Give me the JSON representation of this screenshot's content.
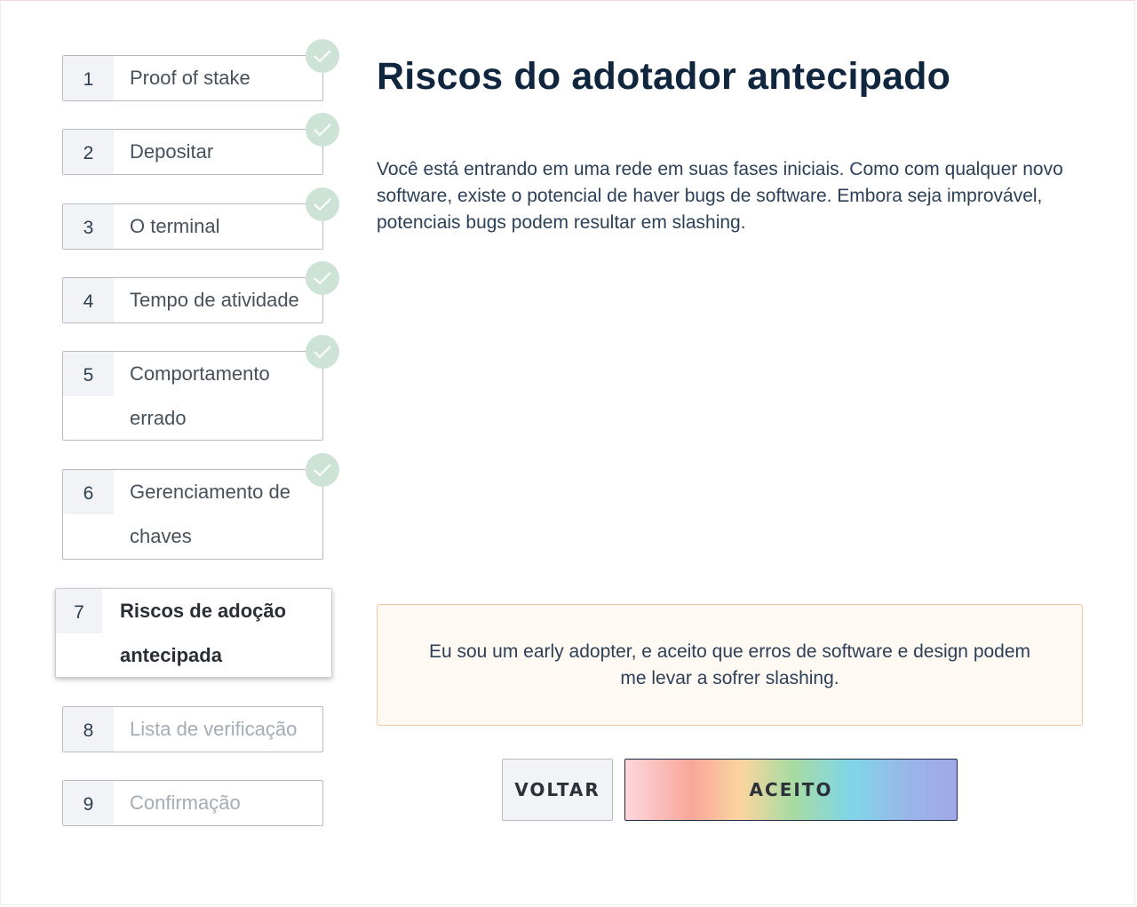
{
  "steps": [
    {
      "number": "1",
      "label": "Proof of stake",
      "state": "done"
    },
    {
      "number": "2",
      "label": "Depositar",
      "state": "done"
    },
    {
      "number": "3",
      "label": "O terminal",
      "state": "done"
    },
    {
      "number": "4",
      "label": "Tempo de atividade",
      "state": "done"
    },
    {
      "number": "5",
      "label": "Comportamento errado",
      "state": "done"
    },
    {
      "number": "6",
      "label": "Gerenciamento de chaves",
      "state": "done"
    },
    {
      "number": "7",
      "label": "Riscos de adoção antecipada",
      "state": "active"
    },
    {
      "number": "8",
      "label": "Lista de verificação",
      "state": "future"
    },
    {
      "number": "9",
      "label": "Confirmação",
      "state": "future"
    }
  ],
  "main": {
    "title": "Riscos do adotador antecipado",
    "body": "Você está entrando em uma rede em suas fases iniciais. Como com qualquer novo software, existe o potencial de haver bugs de software. Embora seja improvável, potenciais bugs podem resultar em slashing.",
    "acknowledgement": "Eu sou um early adopter, e aceito que erros de software e design podem me levar a sofrer slashing."
  },
  "buttons": {
    "back_label": "VOLTAR",
    "accept_label": "ACEITO"
  },
  "icons": {
    "completed": "check-icon"
  },
  "colors": {
    "check_circle": "#cde3d6",
    "ack_box_border": "#f0c9a2",
    "title": "#10263f"
  }
}
